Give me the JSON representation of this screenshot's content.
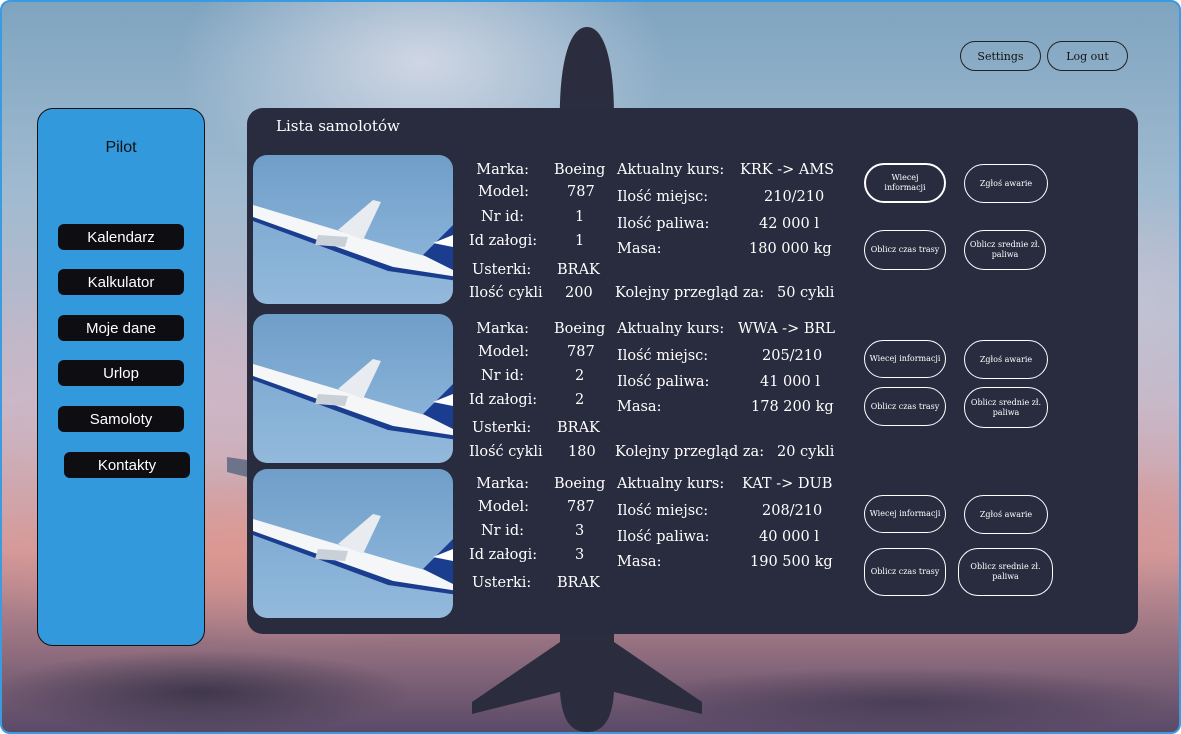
{
  "header": {
    "settings_label": "Settings",
    "logout_label": "Log out"
  },
  "sidebar": {
    "title": "Pilot",
    "items": [
      {
        "label": "Kalendarz"
      },
      {
        "label": "Kalkulator"
      },
      {
        "label": "Moje dane"
      },
      {
        "label": "Urlop"
      },
      {
        "label": "Samoloty"
      },
      {
        "label": "Kontakty"
      }
    ]
  },
  "main": {
    "title": "Lista samolotów",
    "labels": {
      "brand": "Marka:",
      "model": "Model:",
      "id": "Nr id:",
      "crew": "Id załogi:",
      "faults": "Usterki:",
      "cycles": "Ilość cykli",
      "course": "Aktualny kurs:",
      "seats": "Ilość miejsc:",
      "fuel": "Ilość paliwa:",
      "mass": "Masa:",
      "inspection": "Kolejny przegląd za:"
    },
    "actions": {
      "more_info": "Wiecej informacji",
      "report_fault": "Zgłoś awarie",
      "route_time": "Oblicz czas trasy",
      "avg_fuel": "Oblicz srednie zł. paliwa"
    },
    "planes": [
      {
        "brand": "Boeing",
        "model": "787",
        "id": "1",
        "crew": "1",
        "faults": "BRAK",
        "cycles": "200",
        "course": "KRK -> AMS",
        "seats": "210/210",
        "fuel": "42 000 l",
        "mass": "180 000 kg",
        "inspection": "50 cykli"
      },
      {
        "brand": "Boeing",
        "model": "787",
        "id": "2",
        "crew": "2",
        "faults": "BRAK",
        "cycles": "180",
        "course": "WWA -> BRL",
        "seats": "205/210",
        "fuel": "41 000 l",
        "mass": "178 200 kg",
        "inspection": "20 cykli"
      },
      {
        "brand": "Boeing",
        "model": "787",
        "id": "3",
        "crew": "3",
        "faults": "BRAK",
        "course": "KAT -> DUB",
        "seats": "208/210",
        "fuel": "40 000 l",
        "mass": "190 500 kg"
      }
    ]
  },
  "colors": {
    "sidebar": "#3399dd",
    "panel": "#292b3f",
    "nav_button": "#0d0d12"
  },
  "icons": {
    "plane_photo": "airplane-photo"
  }
}
